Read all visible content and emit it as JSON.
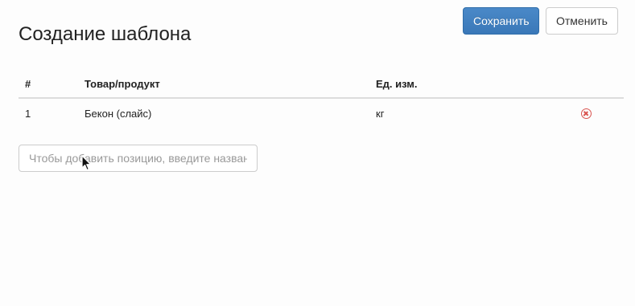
{
  "header": {
    "title": "Создание шаблона",
    "save_label": "Сохранить",
    "cancel_label": "Отменить"
  },
  "table": {
    "columns": [
      "#",
      "Товар/продукт",
      "Ед. изм."
    ],
    "rows": [
      {
        "num": "1",
        "product": "Бекон (слайс)",
        "unit": "кг"
      }
    ]
  },
  "add_position": {
    "placeholder": "Чтобы добавить позицию, введите название"
  },
  "colors": {
    "primary": "#3f7ebf",
    "danger": "#d9534f"
  },
  "icons": {
    "remove": "remove-circle-icon",
    "cursor": "mouse-pointer-icon"
  }
}
